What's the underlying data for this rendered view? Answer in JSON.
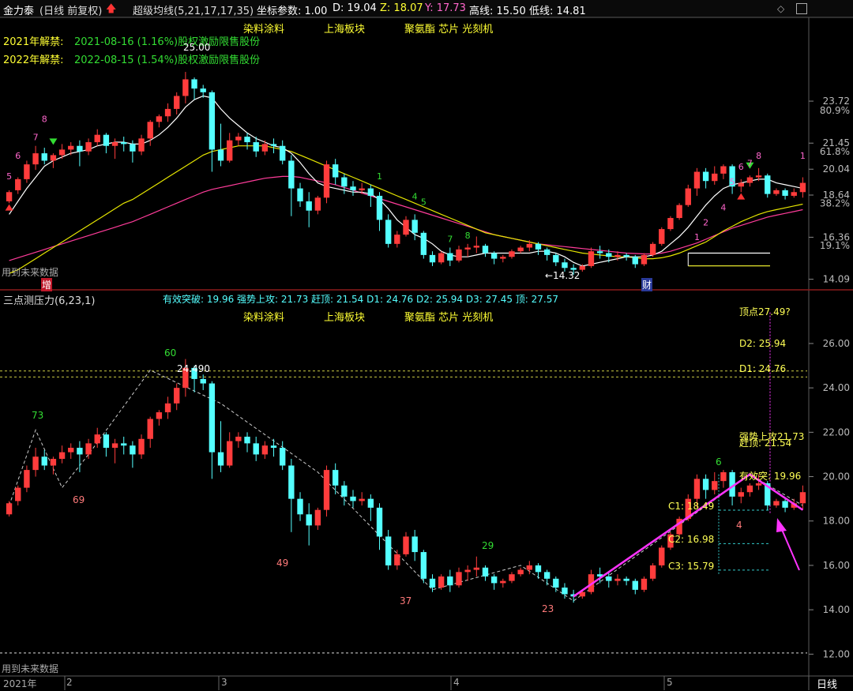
{
  "header": {
    "stock": "金力泰",
    "mode": "(日线 前复权)",
    "indicator": "超级均线(5,21,17,17,35)",
    "params": "坐标参数: 1.00",
    "d_label": "D: 19.04",
    "z_label": "Z: 18.07",
    "y_label": "Y: 17.73",
    "high_line": "高线: 15.50",
    "low_line": "低线: 14.81"
  },
  "concepts": {
    "c1": "染料涂料",
    "c2": "上海板块",
    "c3": "聚氨酯 芯片 光刻机"
  },
  "unlock": {
    "y2021_label": "2021年解禁:",
    "y2021_text": "2021-08-16 (1.16%)股权激励限售股份",
    "y2022_label": "2022-08-15 (1.54%)股权激励限售股份",
    "y2022_title": "2022年解禁:"
  },
  "upper_panel": {
    "future_note": "用到未来数据",
    "marker_add": "增",
    "marker_fin": "财",
    "peak_label": "25.00",
    "low_label": "←14.32",
    "y_ticks": [
      {
        "v": 23.72,
        "t": "23.72"
      },
      {
        "v": 21.45,
        "t": "21.45"
      },
      {
        "v": 20.04,
        "t": "20.04"
      },
      {
        "v": 18.64,
        "t": "18.64"
      },
      {
        "v": 16.36,
        "t": "16.36"
      },
      {
        "v": 14.09,
        "t": "14.09"
      }
    ],
    "pct_ticks": [
      {
        "v": 23.2,
        "t": "80.9%"
      },
      {
        "v": 21.0,
        "t": "61.8%"
      },
      {
        "v": 18.2,
        "t": "38.2%"
      },
      {
        "v": 15.9,
        "t": "19.1%"
      }
    ],
    "range": [
      13.9,
      26.2
    ]
  },
  "lower_panel": {
    "title": "三点测压力(6,23,1)",
    "stats": "有效突破: 19.96  强势上攻: 21.73  赶顶: 21.54  D1: 24.76  D2: 25.94  D3: 27.45  顶: 27.57",
    "future_note": "用到未来数据",
    "pivot_label": "24.490",
    "labels": {
      "d3": "顶点27.49?",
      "d2": "D2: 25.94",
      "d1": "D1: 24.76",
      "strong": "强势上攻21.73",
      "top": "赶顶: 21.54",
      "eff": "有效突: 19.96",
      "c1": "C1: 18.49",
      "c2": "C2: 16.98",
      "c3": "C3: 15.79"
    },
    "counts": {
      "n73": "73",
      "n69": "69",
      "n60": "60",
      "n49": "49",
      "n37": "37",
      "n29": "29",
      "n23": "23",
      "n6": "6",
      "n4": "4"
    },
    "y_ticks": [
      {
        "v": 26.0,
        "t": "26.00"
      },
      {
        "v": 24.0,
        "t": "24.00"
      },
      {
        "v": 22.0,
        "t": "22.00"
      },
      {
        "v": 20.0,
        "t": "20.00"
      },
      {
        "v": 18.0,
        "t": "18.00"
      },
      {
        "v": 16.0,
        "t": "16.00"
      },
      {
        "v": 14.0,
        "t": "14.00"
      },
      {
        "v": 12.0,
        "t": "12.00"
      }
    ],
    "range": [
      11.3,
      27.6
    ]
  },
  "x_axis": {
    "year": "2021年",
    "m2": "2",
    "m3": "3",
    "m4": "4",
    "m5": "5",
    "period": "日线"
  },
  "colors": {
    "up": "#ff3c3c",
    "down": "#54ffff",
    "ma_white": "#ffffff",
    "ma_yellow": "#e6e600",
    "ma_pink": "#ff3c9a",
    "magenta": "#ff33ff",
    "label_yellow": "#ffff55",
    "grid": "#5a5a5a"
  },
  "chart_data": {
    "type": "candlestick",
    "title": "金力泰 日线 前复权",
    "candles": [
      [
        18.3,
        18.9,
        18.8,
        18.2
      ],
      [
        18.9,
        19.6,
        19.5,
        18.7
      ],
      [
        19.5,
        20.5,
        20.3,
        19.3
      ],
      [
        20.3,
        21.3,
        20.9,
        20.0
      ],
      [
        20.9,
        21.2,
        20.5,
        20.3
      ],
      [
        20.5,
        20.9,
        20.8,
        20.1
      ],
      [
        20.8,
        21.4,
        21.1,
        20.6
      ],
      [
        21.1,
        21.5,
        21.3,
        20.8
      ],
      [
        21.3,
        21.6,
        21.0,
        20.2
      ],
      [
        21.0,
        21.7,
        21.5,
        20.8
      ],
      [
        21.5,
        22.2,
        21.9,
        21.3
      ],
      [
        21.9,
        22.0,
        21.3,
        20.9
      ],
      [
        21.3,
        21.7,
        21.5,
        20.6
      ],
      [
        21.5,
        21.8,
        21.4,
        21.0
      ],
      [
        21.4,
        21.6,
        21.0,
        20.4
      ],
      [
        21.0,
        21.9,
        21.7,
        20.8
      ],
      [
        21.7,
        22.7,
        22.6,
        21.3
      ],
      [
        22.6,
        23.0,
        22.9,
        22.3
      ],
      [
        22.9,
        23.6,
        23.3,
        22.6
      ],
      [
        23.3,
        24.2,
        24.0,
        23.0
      ],
      [
        24.0,
        25.3,
        24.9,
        23.6
      ],
      [
        24.9,
        25.0,
        24.4,
        23.8
      ],
      [
        24.4,
        24.6,
        24.2,
        23.9
      ],
      [
        24.2,
        24.3,
        21.1,
        19.9
      ],
      [
        21.1,
        22.5,
        20.5,
        20.2
      ],
      [
        20.5,
        22.0,
        21.6,
        20.4
      ],
      [
        21.6,
        22.0,
        21.8,
        21.3
      ],
      [
        21.8,
        22.0,
        21.5,
        21.1
      ],
      [
        21.5,
        21.8,
        21.0,
        20.7
      ],
      [
        21.0,
        21.6,
        21.4,
        20.8
      ],
      [
        21.4,
        21.7,
        21.3,
        20.9
      ],
      [
        21.3,
        21.6,
        20.5,
        20.3
      ],
      [
        20.5,
        20.8,
        19.0,
        17.5
      ],
      [
        19.0,
        19.3,
        18.3,
        18.0
      ],
      [
        18.3,
        18.8,
        17.8,
        16.9
      ],
      [
        17.8,
        18.6,
        18.5,
        17.6
      ],
      [
        18.5,
        20.5,
        20.3,
        18.2
      ],
      [
        20.3,
        20.6,
        19.6,
        19.2
      ],
      [
        19.6,
        19.8,
        19.1,
        18.7
      ],
      [
        19.1,
        19.4,
        18.9,
        18.6
      ],
      [
        18.9,
        19.3,
        19.0,
        18.7
      ],
      [
        19.0,
        19.2,
        18.6,
        18.0
      ],
      [
        18.6,
        18.8,
        17.3,
        16.7
      ],
      [
        17.3,
        17.6,
        16.0,
        15.8
      ],
      [
        16.0,
        16.7,
        16.5,
        15.8
      ],
      [
        16.5,
        17.5,
        17.3,
        16.4
      ],
      [
        17.3,
        17.6,
        16.6,
        16.2
      ],
      [
        16.6,
        16.7,
        15.4,
        15.2
      ],
      [
        15.4,
        15.6,
        15.0,
        14.8
      ],
      [
        15.0,
        15.6,
        15.5,
        14.9
      ],
      [
        15.5,
        15.8,
        15.1,
        14.8
      ],
      [
        15.1,
        15.9,
        15.7,
        15.0
      ],
      [
        15.7,
        16.0,
        15.8,
        15.3
      ],
      [
        15.8,
        16.4,
        15.9,
        15.5
      ],
      [
        15.9,
        16.0,
        15.5,
        15.3
      ],
      [
        15.5,
        15.6,
        15.2,
        14.9
      ],
      [
        15.2,
        15.4,
        15.3,
        15.0
      ],
      [
        15.3,
        15.7,
        15.6,
        15.2
      ],
      [
        15.6,
        15.9,
        15.8,
        15.5
      ],
      [
        15.8,
        16.2,
        16.0,
        15.6
      ],
      [
        16.0,
        16.1,
        15.7,
        15.4
      ],
      [
        15.7,
        15.8,
        15.4,
        15.1
      ],
      [
        15.4,
        15.5,
        15.0,
        14.8
      ],
      [
        15.0,
        15.2,
        14.7,
        14.5
      ],
      [
        14.7,
        14.9,
        14.6,
        14.32
      ],
      [
        14.6,
        14.9,
        14.8,
        14.5
      ],
      [
        14.8,
        15.8,
        15.6,
        14.7
      ],
      [
        15.6,
        15.9,
        15.5,
        15.2
      ],
      [
        15.5,
        15.7,
        15.3,
        15.0
      ],
      [
        15.3,
        15.6,
        15.4,
        15.1
      ],
      [
        15.4,
        15.5,
        15.3,
        15.1
      ],
      [
        15.3,
        15.4,
        14.9,
        14.7
      ],
      [
        14.9,
        15.5,
        15.4,
        14.8
      ],
      [
        15.4,
        16.1,
        16.0,
        15.3
      ],
      [
        16.0,
        16.9,
        16.8,
        15.9
      ],
      [
        16.8,
        17.5,
        17.4,
        16.7
      ],
      [
        17.4,
        18.2,
        18.1,
        17.3
      ],
      [
        18.1,
        19.2,
        19.0,
        18.0
      ],
      [
        19.0,
        20.1,
        19.9,
        18.6
      ],
      [
        19.9,
        20.1,
        19.4,
        19.0
      ],
      [
        19.4,
        20.2,
        19.8,
        19.2
      ],
      [
        19.8,
        20.3,
        20.2,
        19.5
      ],
      [
        20.2,
        20.3,
        19.1,
        18.7
      ],
      [
        19.1,
        19.5,
        19.3,
        18.8
      ],
      [
        19.3,
        19.7,
        19.6,
        19.1
      ],
      [
        19.6,
        20.1,
        19.7,
        19.4
      ],
      [
        19.7,
        19.8,
        18.7,
        18.5
      ],
      [
        18.7,
        19.0,
        18.9,
        18.6
      ],
      [
        18.9,
        19.0,
        18.6,
        18.4
      ],
      [
        18.6,
        19.0,
        18.8,
        18.5
      ],
      [
        18.8,
        19.6,
        19.3,
        18.5
      ]
    ],
    "ma_white": [
      17.6,
      18.3,
      19.0,
      19.6,
      20.2,
      20.5,
      20.7,
      20.9,
      21.0,
      21.1,
      21.3,
      21.4,
      21.5,
      21.5,
      21.4,
      21.4,
      21.6,
      21.9,
      22.3,
      22.8,
      23.4,
      23.8,
      24.0,
      23.9,
      23.3,
      22.8,
      22.4,
      22.0,
      21.7,
      21.5,
      21.3,
      21.2,
      20.9,
      20.4,
      19.8,
      19.3,
      19.1,
      19.0,
      18.9,
      18.8,
      18.8,
      18.7,
      18.4,
      17.9,
      17.3,
      16.9,
      16.5,
      16.3,
      16.0,
      15.6,
      15.4,
      15.3,
      15.3,
      15.4,
      15.5,
      15.5,
      15.5,
      15.5,
      15.5,
      15.5,
      15.6,
      15.6,
      15.5,
      15.3,
      15.0,
      14.8,
      14.9,
      15.0,
      15.1,
      15.2,
      15.3,
      15.3,
      15.3,
      15.4,
      15.6,
      16.0,
      16.4,
      16.9,
      17.5,
      18.1,
      18.6,
      19.0,
      19.2,
      19.3,
      19.4,
      19.5,
      19.5,
      19.3,
      19.2,
      19.1,
      19.0
    ],
    "ma_yellow": [
      14.4,
      14.6,
      14.9,
      15.2,
      15.5,
      15.8,
      16.1,
      16.4,
      16.7,
      17.0,
      17.3,
      17.6,
      17.9,
      18.2,
      18.4,
      18.7,
      19.0,
      19.3,
      19.6,
      19.9,
      20.2,
      20.5,
      20.8,
      21.0,
      21.1,
      21.2,
      21.3,
      21.3,
      21.3,
      21.3,
      21.2,
      21.1,
      21.0,
      20.8,
      20.6,
      20.4,
      20.2,
      20.0,
      19.8,
      19.6,
      19.4,
      19.2,
      19.0,
      18.8,
      18.6,
      18.4,
      18.2,
      18.0,
      17.8,
      17.6,
      17.4,
      17.2,
      17.0,
      16.8,
      16.6,
      16.5,
      16.4,
      16.3,
      16.2,
      16.1,
      16.0,
      15.9,
      15.8,
      15.7,
      15.6,
      15.5,
      15.45,
      15.4,
      15.35,
      15.3,
      15.3,
      15.25,
      15.2,
      15.2,
      15.25,
      15.35,
      15.5,
      15.7,
      15.9,
      16.1,
      16.4,
      16.7,
      16.95,
      17.2,
      17.4,
      17.6,
      17.75,
      17.85,
      17.95,
      18.05,
      18.15
    ],
    "ma_pink": [
      15.1,
      15.25,
      15.4,
      15.55,
      15.7,
      15.85,
      16.0,
      16.15,
      16.3,
      16.45,
      16.6,
      16.75,
      16.9,
      17.05,
      17.2,
      17.4,
      17.6,
      17.8,
      18.0,
      18.2,
      18.4,
      18.6,
      18.8,
      18.95,
      19.05,
      19.15,
      19.25,
      19.35,
      19.45,
      19.55,
      19.6,
      19.65,
      19.65,
      19.6,
      19.5,
      19.4,
      19.3,
      19.2,
      19.05,
      18.9,
      18.75,
      18.6,
      18.45,
      18.3,
      18.15,
      18.0,
      17.85,
      17.7,
      17.55,
      17.4,
      17.25,
      17.1,
      16.95,
      16.8,
      16.65,
      16.5,
      16.4,
      16.3,
      16.2,
      16.1,
      16.0,
      15.95,
      15.9,
      15.85,
      15.8,
      15.75,
      15.7,
      15.65,
      15.6,
      15.55,
      15.5,
      15.48,
      15.46,
      15.45,
      15.5,
      15.6,
      15.75,
      15.9,
      16.05,
      16.25,
      16.45,
      16.65,
      16.85,
      17.0,
      17.15,
      17.3,
      17.45,
      17.55,
      17.65,
      17.75,
      17.85
    ]
  }
}
